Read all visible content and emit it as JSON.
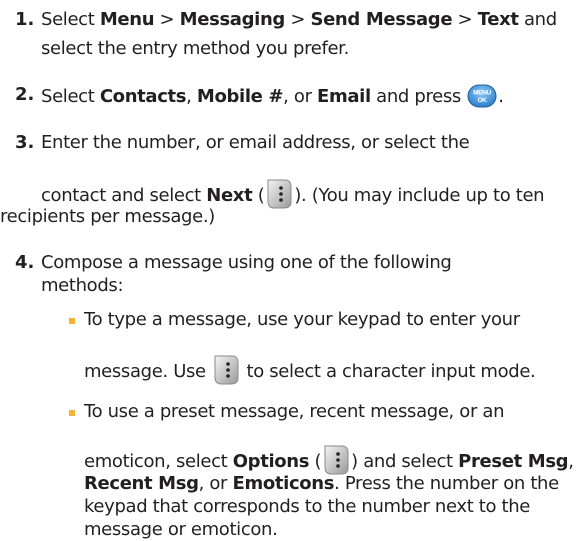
{
  "steps": [
    {
      "number": "1.",
      "lines": [
        {
          "t1": "Select ",
          "b1": "Menu",
          "t2": " > ",
          "b2": "Messaging",
          "t3": " > ",
          "b3": "Send Message",
          "t4": " > ",
          "b4": "Text",
          "t5": " and"
        },
        {
          "t1": "select the entry method you prefer."
        }
      ]
    },
    {
      "number": "2.",
      "lines": [
        {
          "t1": "Select ",
          "b1": "Contacts",
          "t2": ", ",
          "b2": "Mobile #",
          "t3": ", or ",
          "b3": "Email",
          "t4": " and press ",
          "t5": "."
        }
      ]
    },
    {
      "number": "3.",
      "lines": [
        {
          "t1": "Enter the number, or email address, or select the"
        },
        {
          "t1": "contact and select ",
          "b1": "Next",
          "t2": " (",
          "t3": "). (You may include up to ten"
        },
        {
          "t1": "recipients per message.)"
        }
      ]
    },
    {
      "number": "4.",
      "lines": [
        {
          "t1": "Compose a message using one of the following"
        },
        {
          "t1": "methods:"
        }
      ]
    }
  ],
  "bullets": [
    {
      "lines": [
        {
          "t1": "To type a message, use your keypad to enter your"
        },
        {
          "t1": "message. Use ",
          "t2": " to select a character input mode."
        }
      ]
    },
    {
      "lines": [
        {
          "t1": "To use a preset message, recent message, or an"
        },
        {
          "t1": "emoticon, select ",
          "b1": "Options",
          "t2": " (",
          "t3": ") and select ",
          "b2": "Preset Msg",
          "t4": ","
        },
        {
          "b1": "Recent Msg",
          "t1": ", or ",
          "b2": "Emoticons",
          "t2": ". Press the number on the"
        },
        {
          "t1": "keypad that corresponds to the number next to the"
        },
        {
          "t1": "message or emoticon."
        }
      ]
    }
  ],
  "icons": {
    "menu_ok_top": "MENU",
    "menu_ok_bottom": "OK",
    "menu_ok_name": "menu-ok-key-icon",
    "softkey_name": "right-softkey-icon",
    "accent": "#4a97dc",
    "bullet_color": "#f2b233"
  }
}
